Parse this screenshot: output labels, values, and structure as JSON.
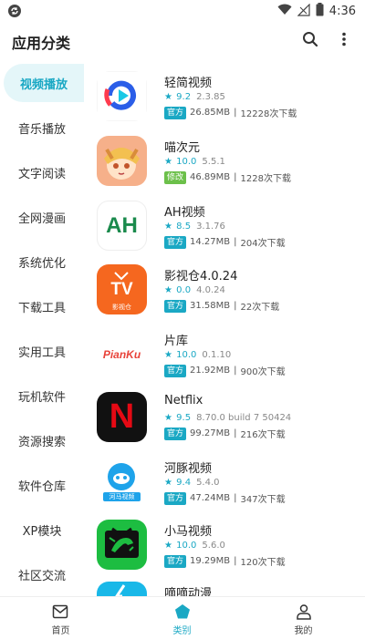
{
  "status_bar": {
    "time": "4:36"
  },
  "app_bar": {
    "title": "应用分类"
  },
  "sidebar": {
    "items": [
      {
        "label": "视频播放",
        "active": true
      },
      {
        "label": "音乐播放"
      },
      {
        "label": "文字阅读"
      },
      {
        "label": "全网漫画"
      },
      {
        "label": "系统优化"
      },
      {
        "label": "下载工具"
      },
      {
        "label": "实用工具"
      },
      {
        "label": "玩机软件"
      },
      {
        "label": "资源搜索"
      },
      {
        "label": "软件仓库"
      },
      {
        "label": "XP模块"
      },
      {
        "label": "社区交流"
      }
    ]
  },
  "apps": [
    {
      "name": "轻简视频",
      "rating": "9.2",
      "version": "2.3.85",
      "badge": "官方",
      "size": "26.85MB",
      "downloads": "12228次下载",
      "icon": "qingjian-icon"
    },
    {
      "name": "喵次元",
      "rating": "10.0",
      "version": "5.5.1",
      "badge": "修改",
      "size": "46.89MB",
      "downloads": "1228次下载",
      "icon": "miaociyuan-icon"
    },
    {
      "name": "AH视频",
      "rating": "8.5",
      "version": "3.1.76",
      "badge": "官方",
      "size": "14.27MB",
      "downloads": "204次下载",
      "icon": "ah-icon",
      "icon_text": "AH"
    },
    {
      "name": "影视仓4.0.24",
      "rating": "0.0",
      "version": "4.0.24",
      "badge": "官方",
      "size": "31.58MB",
      "downloads": "22次下载",
      "icon": "yingshicang-icon",
      "icon_text": "TV",
      "icon_sub": "影视仓"
    },
    {
      "name": "片库",
      "rating": "10.0",
      "version": "0.1.10",
      "badge": "官方",
      "size": "21.92MB",
      "downloads": "900次下载",
      "icon": "pianku-icon",
      "icon_text": "PianKu"
    },
    {
      "name": "Netflix",
      "rating": "9.5",
      "version": "8.70.0 build 7 50424",
      "badge": "官方",
      "size": "99.27MB",
      "downloads": "216次下载",
      "icon": "netflix-icon",
      "icon_text": "N"
    },
    {
      "name": "河豚视频",
      "rating": "9.4",
      "version": "5.4.0",
      "badge": "官方",
      "size": "47.24MB",
      "downloads": "347次下载",
      "icon": "hetun-icon",
      "icon_sub": "河马视频"
    },
    {
      "name": "小马视频",
      "rating": "10.0",
      "version": "5.6.0",
      "badge": "官方",
      "size": "19.29MB",
      "downloads": "120次下载",
      "icon": "xiaoma-icon"
    },
    {
      "name": "嘀嘀动漫",
      "icon": "didi-icon"
    }
  ],
  "bottom_nav": {
    "items": [
      {
        "label": "首页",
        "icon": "home-icon"
      },
      {
        "label": "类别",
        "icon": "category-icon",
        "active": true
      },
      {
        "label": "我的",
        "icon": "person-icon"
      }
    ]
  },
  "colors": {
    "accent": "#1aa8c4",
    "mod_badge": "#6cc04a"
  }
}
